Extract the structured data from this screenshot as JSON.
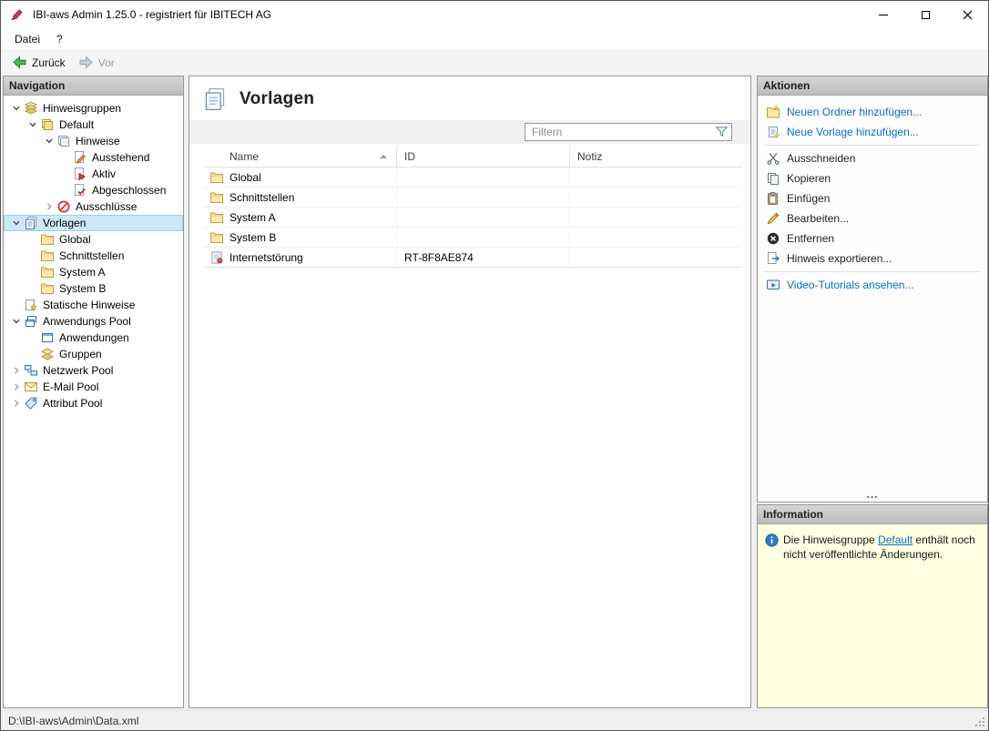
{
  "window": {
    "title": "IBI-aws Admin 1.25.0 - registriert für IBITECH AG"
  },
  "menu": {
    "items": [
      {
        "label": "Datei"
      },
      {
        "label": "?"
      }
    ]
  },
  "toolbar": {
    "back": "Zurück",
    "forward": "Vor"
  },
  "navigation": {
    "header": "Navigation",
    "items": [
      {
        "label": "Hinweisgruppen",
        "icon": "hinweisgruppen-icon",
        "level": 0,
        "state": "expanded"
      },
      {
        "label": "Default",
        "icon": "default-group-icon",
        "level": 1,
        "state": "expanded"
      },
      {
        "label": "Hinweise",
        "icon": "hinweise-icon",
        "level": 2,
        "state": "expanded"
      },
      {
        "label": "Ausstehend",
        "icon": "ausstehend-icon",
        "level": 3,
        "state": "leaf"
      },
      {
        "label": "Aktiv",
        "icon": "aktiv-icon",
        "level": 3,
        "state": "leaf"
      },
      {
        "label": "Abgeschlossen",
        "icon": "abgeschlossen-icon",
        "level": 3,
        "state": "leaf"
      },
      {
        "label": "Ausschlüsse",
        "icon": "ausschluesse-icon",
        "level": 2,
        "state": "collapsed"
      },
      {
        "label": "Vorlagen",
        "icon": "vorlagen-icon",
        "level": 0,
        "state": "expanded",
        "selected": true
      },
      {
        "label": "Global",
        "icon": "folder-icon",
        "level": 1,
        "state": "leaf"
      },
      {
        "label": "Schnittstellen",
        "icon": "folder-icon",
        "level": 1,
        "state": "leaf"
      },
      {
        "label": "System A",
        "icon": "folder-icon",
        "level": 1,
        "state": "leaf"
      },
      {
        "label": "System B",
        "icon": "folder-icon",
        "level": 1,
        "state": "leaf"
      },
      {
        "label": "Statische Hinweise",
        "icon": "statische-hinweise-icon",
        "level": 0,
        "state": "leaf"
      },
      {
        "label": "Anwendungs Pool",
        "icon": "anwendungs-pool-icon",
        "level": 0,
        "state": "expanded"
      },
      {
        "label": "Anwendungen",
        "icon": "anwendungen-icon",
        "level": 1,
        "state": "leaf"
      },
      {
        "label": "Gruppen",
        "icon": "gruppen-icon",
        "level": 1,
        "state": "leaf"
      },
      {
        "label": "Netzwerk Pool",
        "icon": "netzwerk-pool-icon",
        "level": 0,
        "state": "collapsed"
      },
      {
        "label": "E-Mail Pool",
        "icon": "email-pool-icon",
        "level": 0,
        "state": "collapsed"
      },
      {
        "label": "Attribut Pool",
        "icon": "attribut-pool-icon",
        "level": 0,
        "state": "collapsed"
      }
    ]
  },
  "main": {
    "title": "Vorlagen",
    "icon": "vorlagen-page-icon",
    "filter_placeholder": "Filtern",
    "table": {
      "columns": [
        "Name",
        "ID",
        "Notiz"
      ],
      "sort": {
        "column": "Name",
        "direction": "ascending"
      },
      "rows": [
        {
          "name": "Global",
          "id": "",
          "notiz": "",
          "icon": "folder-icon"
        },
        {
          "name": "Schnittstellen",
          "id": "",
          "notiz": "",
          "icon": "folder-icon"
        },
        {
          "name": "System A",
          "id": "",
          "notiz": "",
          "icon": "folder-icon"
        },
        {
          "name": "System B",
          "id": "",
          "notiz": "",
          "icon": "folder-icon"
        },
        {
          "name": "Internetstörung",
          "id": "RT-8F8AE874",
          "notiz": "",
          "icon": "template-icon"
        }
      ]
    }
  },
  "actions": {
    "header": "Aktionen",
    "more": "...",
    "items": [
      {
        "label": "Neuen Ordner hinzufügen...",
        "icon": "new-folder-icon",
        "style": "link"
      },
      {
        "label": "Neue Vorlage hinzufügen...",
        "icon": "new-template-icon",
        "style": "link"
      },
      {
        "label": "Ausschneiden",
        "icon": "scissors-icon",
        "style": "normal"
      },
      {
        "label": "Kopieren",
        "icon": "copy-icon",
        "style": "normal"
      },
      {
        "label": "Einfügen",
        "icon": "paste-icon",
        "style": "normal"
      },
      {
        "label": "Bearbeiten...",
        "icon": "edit-pencil-icon",
        "style": "normal"
      },
      {
        "label": "Entfernen",
        "icon": "remove-icon",
        "style": "normal"
      },
      {
        "label": "Hinweis exportieren...",
        "icon": "export-icon",
        "style": "normal"
      },
      {
        "label": "Video-Tutorials ansehen...",
        "icon": "video-icon",
        "style": "link"
      }
    ]
  },
  "information": {
    "header": "Information",
    "icon": "info-icon",
    "text_before": "Die Hinweisgruppe ",
    "link": "Default",
    "text_after": " enthält noch nicht veröffentlichte Änderungen."
  },
  "statusbar": {
    "path": "D:\\IBI-aws\\Admin\\Data.xml"
  },
  "colors": {
    "selection": "#cde8f7",
    "link": "#0a6cc8",
    "info_background": "#ffffe1",
    "panel_header": "#c6c6c6"
  }
}
